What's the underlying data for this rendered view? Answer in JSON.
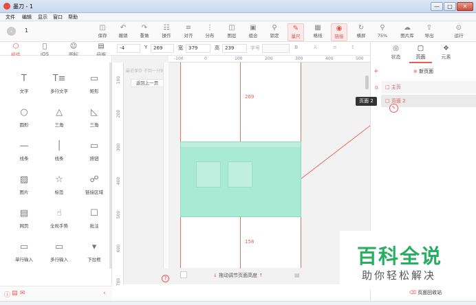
{
  "window": {
    "title": "墨刀 - 1",
    "minimize": "—",
    "maximize": "□",
    "close": "✕"
  },
  "menu": [
    "文件",
    "编辑",
    "显示",
    "窗口",
    "帮助"
  ],
  "toolbar": {
    "page_number": "1",
    "items": [
      {
        "label": "保存",
        "icon": "save-icon"
      },
      {
        "label": "撤销",
        "icon": "undo-icon"
      },
      {
        "label": "重做",
        "icon": "redo-icon"
      },
      {
        "label": "操作",
        "icon": "action-icon"
      },
      {
        "label": "对齐",
        "icon": "align-icon"
      },
      {
        "label": "分布",
        "icon": "distribute-icon"
      },
      {
        "label": "图层",
        "icon": "layer-icon"
      },
      {
        "label": "组合",
        "icon": "group-icon"
      },
      {
        "label": "锁定",
        "icon": "lock-icon"
      },
      {
        "label": "量尺",
        "icon": "ruler-icon"
      },
      {
        "label": "格线",
        "icon": "grid-icon"
      },
      {
        "label": "链接",
        "icon": "link-icon"
      },
      {
        "label": "横屏",
        "icon": "rotate-icon"
      },
      {
        "label": "75%",
        "icon": "zoom-icon"
      },
      {
        "label": "图片库",
        "icon": "image-library-icon"
      },
      {
        "label": "导出",
        "icon": "export-icon"
      },
      {
        "label": "运行",
        "icon": "run-icon"
      }
    ]
  },
  "props": {
    "x": "-4",
    "y_label": "Y",
    "y": "269",
    "w_label": "宽",
    "w": "379",
    "h_label": "高",
    "h": "239",
    "font_label": "字号"
  },
  "left_tabs": [
    {
      "label": "组件",
      "icon": "component-icon"
    },
    {
      "label": "iOS",
      "icon": "apple-icon"
    },
    {
      "label": "图标",
      "icon": "emoji-icon"
    },
    {
      "label": "母版",
      "icon": "master-icon"
    }
  ],
  "components": [
    {
      "label": "文字",
      "icon": "T"
    },
    {
      "label": "多行文字",
      "icon": "T≡"
    },
    {
      "label": "矩形",
      "icon": "▭"
    },
    {
      "label": "圆形",
      "icon": "○"
    },
    {
      "label": "三角",
      "icon": "△"
    },
    {
      "label": "三角",
      "icon": "◺"
    },
    {
      "label": "线条",
      "icon": "—"
    },
    {
      "label": "线条",
      "icon": "│"
    },
    {
      "label": "按钮",
      "icon": "▭"
    },
    {
      "label": "图片",
      "icon": "▨"
    },
    {
      "label": "标签",
      "icon": "☆"
    },
    {
      "label": "链接区域",
      "icon": "☍"
    },
    {
      "label": "网页",
      "icon": "▤"
    },
    {
      "label": "全局手势",
      "icon": "☝"
    },
    {
      "label": "批注",
      "icon": "☐"
    },
    {
      "label": "单行输入",
      "icon": "▭"
    },
    {
      "label": "多行输入",
      "icon": "▭"
    },
    {
      "label": "下拉框",
      "icon": "▾"
    }
  ],
  "canvas": {
    "hint": "最近保存  不到一分钟",
    "back_button": "返回上一页",
    "ruler_top": [
      "-100",
      "0",
      "100",
      "200",
      "300",
      "400",
      "500"
    ],
    "ruler_left": [
      "100",
      "200",
      "300",
      "400",
      "500",
      "600",
      "700"
    ],
    "dim_top": "269",
    "dim_bottom": "158",
    "drag_hint": "拖动调节页面高度"
  },
  "right_tabs": [
    {
      "label": "状态",
      "icon": "state-icon"
    },
    {
      "label": "页面",
      "icon": "page-icon"
    },
    {
      "label": "元素",
      "icon": "element-icon"
    }
  ],
  "pages": {
    "new_page": "新页面",
    "items": [
      {
        "label": "主页",
        "index": "0"
      },
      {
        "label": "页面 2",
        "index": ""
      }
    ],
    "tooltip": "页面 2",
    "recycle": "页面回收站"
  },
  "watermark": {
    "title": "百科全说",
    "subtitle": "助你轻松解决"
  },
  "colors": {
    "accent": "#e55353",
    "green": "#27ae60",
    "screen": "#a8ead3"
  }
}
